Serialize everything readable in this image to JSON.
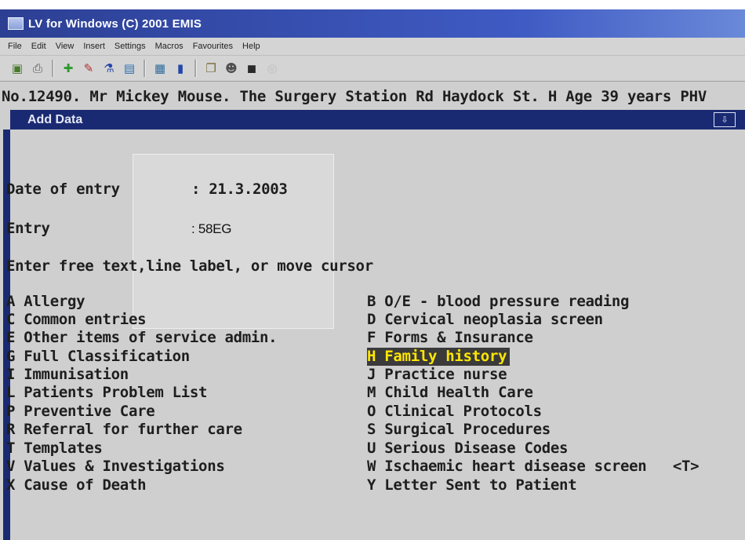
{
  "window": {
    "title": "LV for Windows (C) 2001 EMIS"
  },
  "menu": [
    "File",
    "Edit",
    "View",
    "Insert",
    "Settings",
    "Macros",
    "Favourites",
    "Help"
  ],
  "toolbar": {
    "icons": [
      {
        "name": "patient-icon",
        "glyph": "▣",
        "color": "#4a7a2c"
      },
      {
        "name": "printer-icon",
        "glyph": "⎙",
        "color": "#555555"
      },
      {
        "name": "add-icon",
        "glyph": "✚",
        "color": "#2e9a2e"
      },
      {
        "name": "record-icon",
        "glyph": "✎",
        "color": "#b03030"
      },
      {
        "name": "flask-icon",
        "glyph": "⚗",
        "color": "#2747a8"
      },
      {
        "name": "folder-icon",
        "glyph": "▤",
        "color": "#2c6fb0"
      },
      {
        "name": "chart-icon",
        "glyph": "▦",
        "color": "#2f6b9c"
      },
      {
        "name": "bottle-icon",
        "glyph": "▮",
        "color": "#2348a8"
      },
      {
        "name": "copy-icon",
        "glyph": "❐",
        "color": "#7a6a3a"
      },
      {
        "name": "people-icon",
        "glyph": "☻",
        "color": "#4f4f4f"
      },
      {
        "name": "card-icon",
        "glyph": "◼",
        "color": "#2a2a2a"
      },
      {
        "name": "cd-icon",
        "glyph": "◎",
        "color": "#bdbdbd"
      }
    ]
  },
  "patient_line": "No.12490. Mr Mickey Mouse. The Surgery Station Rd Haydock St. H Age 39 years PHV",
  "panel": {
    "title": "Add Data",
    "button_glyph": "⇩"
  },
  "form": {
    "date_label": "Date of entry",
    "date_value": ": 21.3.2003",
    "entry_label": "Entry",
    "entry_value": ": 58EG",
    "prompt": "Enter free text,line label, or move cursor"
  },
  "options_left": [
    "A Allergy",
    "C Common entries",
    "E Other items of service admin.",
    "G Full Classification",
    "I Immunisation",
    "L Patients Problem List",
    "P Preventive Care",
    "R Referral for further care",
    "T Templates",
    "V Values & Investigations",
    "X Cause of Death"
  ],
  "options_right": [
    "B O/E - blood pressure reading",
    "D Cervical neoplasia screen",
    "F Forms & Insurance",
    "H Family history",
    "J Practice nurse",
    "M Child Health Care",
    "O Clinical Protocols",
    "S Surgical Procedures",
    "U Serious Disease Codes",
    "W Ischaemic heart disease screen   <T>",
    "Y Letter Sent to Patient"
  ],
  "selected_option": "H Family history"
}
